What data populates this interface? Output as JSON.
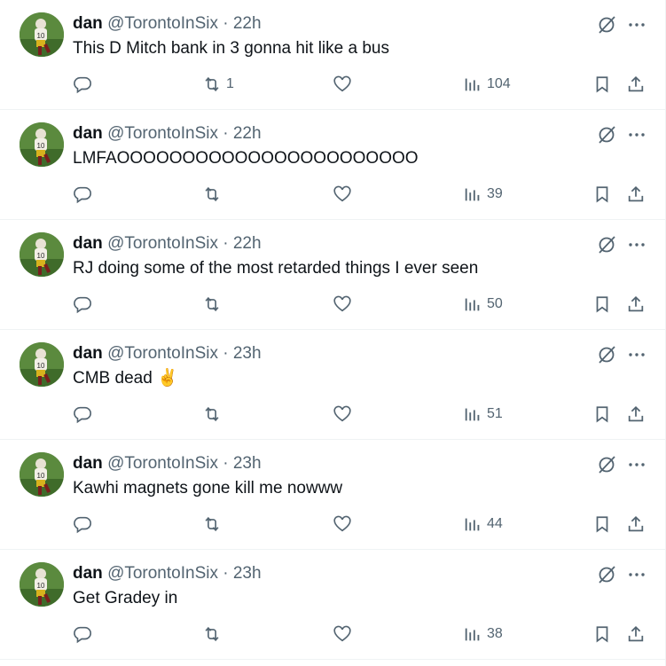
{
  "icons": {
    "reply": "reply-icon",
    "retweet": "retweet-icon",
    "like": "like-icon",
    "views": "views-icon",
    "bookmark": "bookmark-icon",
    "share": "share-icon",
    "grok": "grok-icon",
    "more": "more-icon"
  },
  "colors": {
    "text": "#0f1419",
    "secondary": "#536471",
    "border": "#eff3f4"
  },
  "tweets": [
    {
      "name": "dan",
      "handle": "@TorontoInSix",
      "sep": "·",
      "time": "22h",
      "text": "This D Mitch bank in 3 gonna hit like a bus",
      "reply_count": "",
      "retweet_count": "1",
      "like_count": "",
      "views": "104"
    },
    {
      "name": "dan",
      "handle": "@TorontoInSix",
      "sep": "·",
      "time": "22h",
      "text": "LMFAOOOOOOOOOOOOOOOOOOOOOOO",
      "reply_count": "",
      "retweet_count": "",
      "like_count": "",
      "views": "39"
    },
    {
      "name": "dan",
      "handle": "@TorontoInSix",
      "sep": "·",
      "time": "22h",
      "text": "RJ doing some of the most retarded things I ever seen",
      "reply_count": "",
      "retweet_count": "",
      "like_count": "",
      "views": "50"
    },
    {
      "name": "dan",
      "handle": "@TorontoInSix",
      "sep": "·",
      "time": "23h",
      "text": "CMB dead ✌️",
      "reply_count": "",
      "retweet_count": "",
      "like_count": "",
      "views": "51"
    },
    {
      "name": "dan",
      "handle": "@TorontoInSix",
      "sep": "·",
      "time": "23h",
      "text": "Kawhi magnets gone kill me nowww",
      "reply_count": "",
      "retweet_count": "",
      "like_count": "",
      "views": "44"
    },
    {
      "name": "dan",
      "handle": "@TorontoInSix",
      "sep": "·",
      "time": "23h",
      "text": "Get Gradey in",
      "reply_count": "",
      "retweet_count": "",
      "like_count": "",
      "views": "38"
    }
  ]
}
